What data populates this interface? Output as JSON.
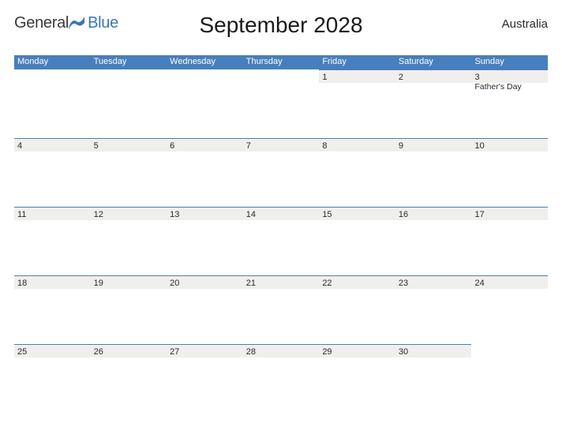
{
  "brand": {
    "part1": "General",
    "part2": "Blue"
  },
  "title": "September 2028",
  "country": "Australia",
  "weekdays": [
    "Monday",
    "Tuesday",
    "Wednesday",
    "Thursday",
    "Friday",
    "Saturday",
    "Sunday"
  ],
  "weeks": [
    [
      {
        "num": "",
        "event": ""
      },
      {
        "num": "",
        "event": ""
      },
      {
        "num": "",
        "event": ""
      },
      {
        "num": "",
        "event": ""
      },
      {
        "num": "1",
        "event": ""
      },
      {
        "num": "2",
        "event": ""
      },
      {
        "num": "3",
        "event": "Father's Day"
      }
    ],
    [
      {
        "num": "4",
        "event": ""
      },
      {
        "num": "5",
        "event": ""
      },
      {
        "num": "6",
        "event": ""
      },
      {
        "num": "7",
        "event": ""
      },
      {
        "num": "8",
        "event": ""
      },
      {
        "num": "9",
        "event": ""
      },
      {
        "num": "10",
        "event": ""
      }
    ],
    [
      {
        "num": "11",
        "event": ""
      },
      {
        "num": "12",
        "event": ""
      },
      {
        "num": "13",
        "event": ""
      },
      {
        "num": "14",
        "event": ""
      },
      {
        "num": "15",
        "event": ""
      },
      {
        "num": "16",
        "event": ""
      },
      {
        "num": "17",
        "event": ""
      }
    ],
    [
      {
        "num": "18",
        "event": ""
      },
      {
        "num": "19",
        "event": ""
      },
      {
        "num": "20",
        "event": ""
      },
      {
        "num": "21",
        "event": ""
      },
      {
        "num": "22",
        "event": ""
      },
      {
        "num": "23",
        "event": ""
      },
      {
        "num": "24",
        "event": ""
      }
    ],
    [
      {
        "num": "25",
        "event": ""
      },
      {
        "num": "26",
        "event": ""
      },
      {
        "num": "27",
        "event": ""
      },
      {
        "num": "28",
        "event": ""
      },
      {
        "num": "29",
        "event": ""
      },
      {
        "num": "30",
        "event": ""
      },
      {
        "num": "",
        "event": ""
      }
    ]
  ]
}
